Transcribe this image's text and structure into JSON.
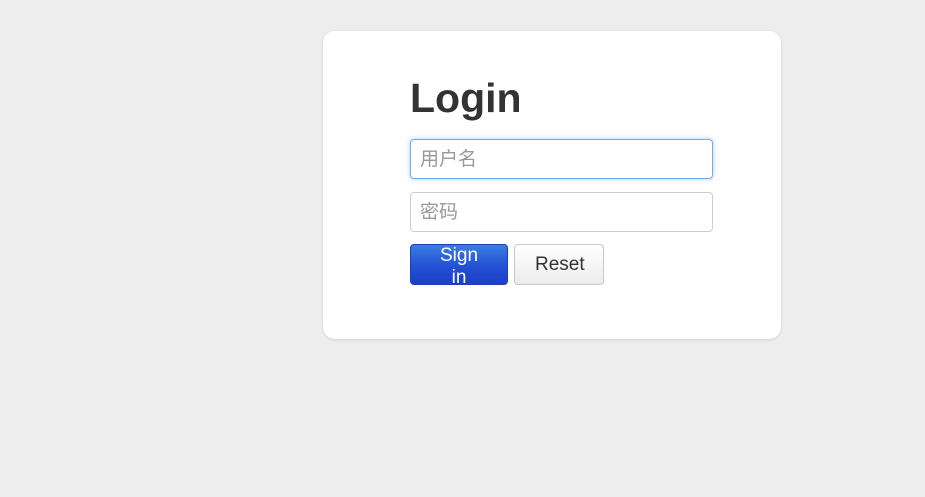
{
  "login": {
    "title": "Login",
    "username_placeholder": "用户名",
    "password_placeholder": "密码",
    "sign_in_label": "Sign in",
    "reset_label": "Reset"
  },
  "colors": {
    "page_background": "#ededed",
    "card_background": "#ffffff",
    "primary_button": "#2350d4",
    "focus_border": "#7aa9f0"
  }
}
